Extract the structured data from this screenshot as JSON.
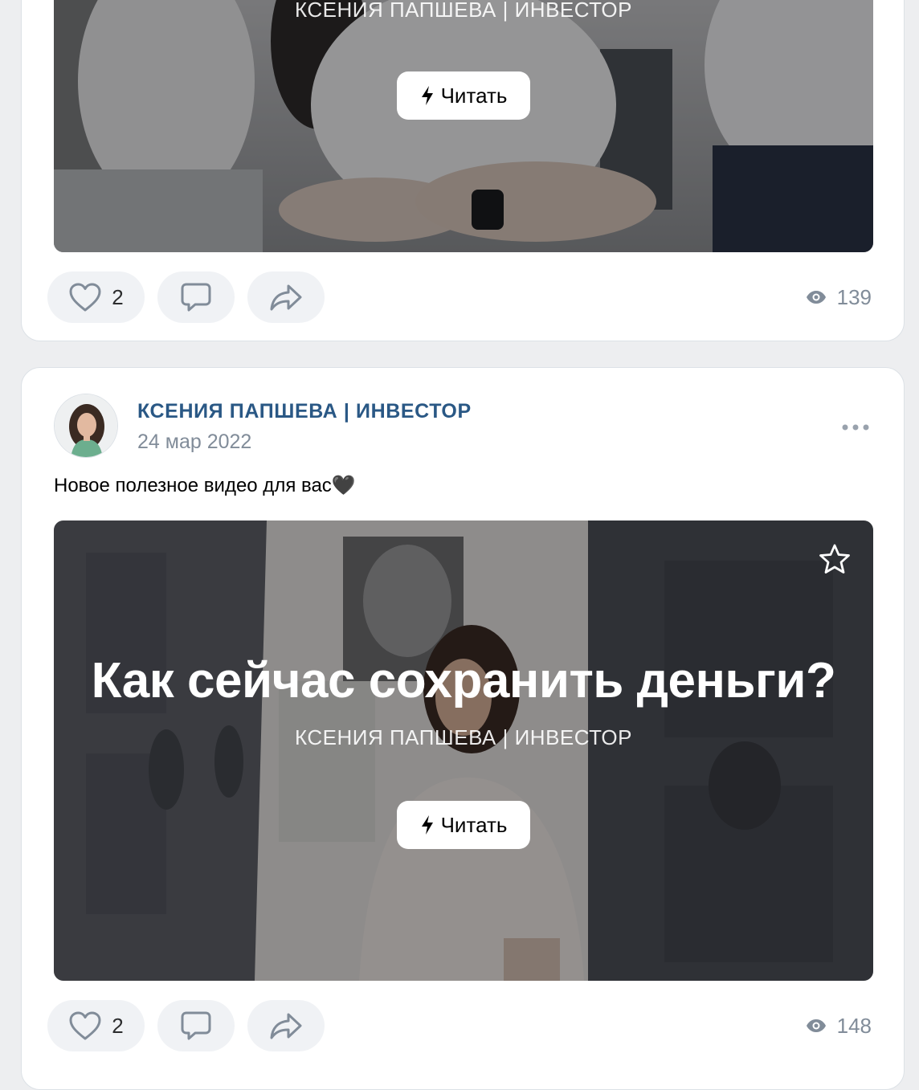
{
  "posts": [
    {
      "cover": {
        "author": "КСЕНИЯ ПАПШЕВА | ИНВЕСТОР",
        "read_label": "Читать"
      },
      "actions": {
        "likes": "2",
        "views": "139"
      }
    },
    {
      "author": "КСЕНИЯ ПАПШЕВА | ИНВЕСТОР",
      "date": "24 мар 2022",
      "text": "Новое полезное видео для вас🖤",
      "cover": {
        "title": "Как сейчас сохранить деньги?",
        "author": "КСЕНИЯ ПАПШЕВА | ИНВЕСТОР",
        "read_label": "Читать"
      },
      "actions": {
        "likes": "2",
        "views": "148"
      }
    }
  ],
  "icons": {
    "like": "heart-icon",
    "comment": "comment-icon",
    "share": "share-icon",
    "views": "eye-icon",
    "more": "more-dots-icon",
    "bookmark": "star-icon",
    "read": "lightning-icon"
  },
  "colors": {
    "link": "#2a5885",
    "muted": "#818c99",
    "pill": "#f0f2f5",
    "background": "#edeef0"
  }
}
